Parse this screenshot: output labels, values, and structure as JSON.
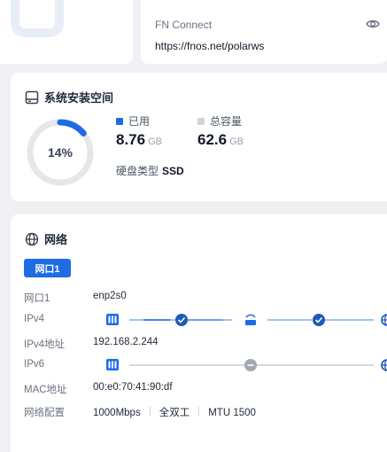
{
  "fn_connect": {
    "title": "FN Connect",
    "url": "https://fnos.net/polarws"
  },
  "storage": {
    "title": "系统安装空间",
    "percent_label": "14%",
    "used_fraction": 0.14,
    "used_label": "已用",
    "used_value": "8.76",
    "used_unit": "GB",
    "total_label": "总容量",
    "total_value": "62.6",
    "total_unit": "GB",
    "disk_type_label": "硬盘类型",
    "disk_type_value": "SSD"
  },
  "network": {
    "title": "网络",
    "tab": "网口1",
    "rows": {
      "port_label": "网口1",
      "port_value": "enp2s0",
      "ipv4_label": "IPv4",
      "ipv4_addr_label": "IPv4地址",
      "ipv4_addr_value": "192.168.2.244",
      "ipv6_label": "IPv6",
      "mac_label": "MAC地址",
      "mac_value": "00:e0:70:41:90:df",
      "config_label": "网络配置",
      "speed": "1000Mbps",
      "duplex": "全双工",
      "mtu": "MTU 1500"
    }
  },
  "colors": {
    "accent": "#1e6be6",
    "ring_track": "#e5e7eb",
    "ok_node": "#1e6be6",
    "disabled_node": "#9ca3af"
  }
}
